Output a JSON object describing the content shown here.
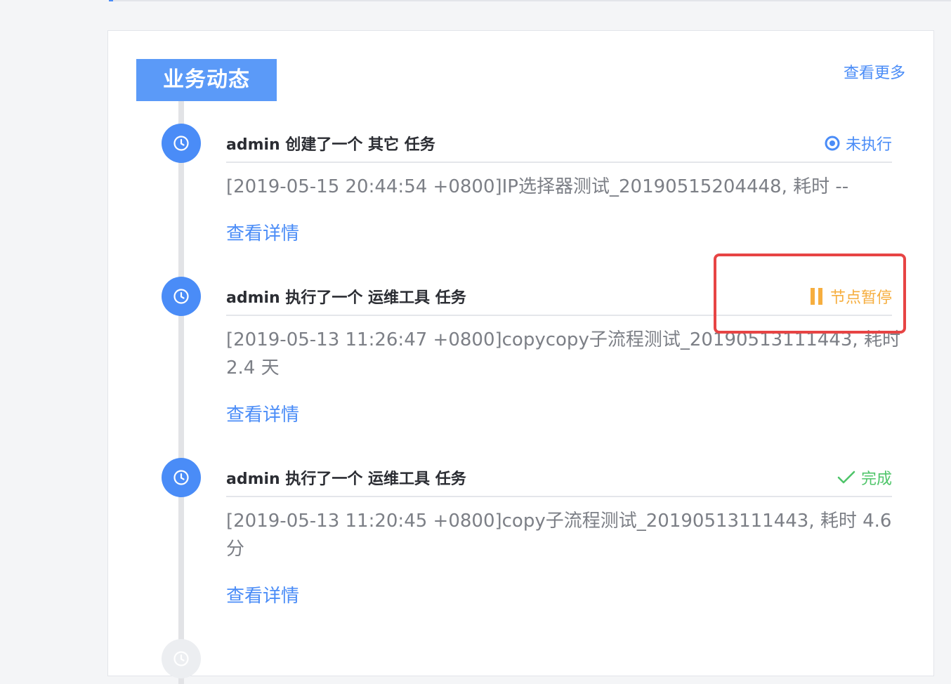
{
  "card": {
    "title": "业务动态",
    "view_more": "查看更多"
  },
  "entries": [
    {
      "header": "admin 创建了一个 其它 任务",
      "status": "未执行",
      "status_icon": "radio-dot-icon",
      "status_color": "#4a8cf7",
      "description": "[2019-05-15 20:44:54 +0800]IP选择器测试_20190515204448, 耗时 --",
      "detail_link": "查看详情"
    },
    {
      "header": "admin 执行了一个 运维工具 任务",
      "status": "节点暂停",
      "status_icon": "pause-icon",
      "status_color": "#f6ae3f",
      "description": "[2019-05-13 11:26:47 +0800]copycopy子流程测试_20190513111443, 耗时 2.4 天",
      "detail_link": "查看详情"
    },
    {
      "header": "admin 执行了一个 运维工具 任务",
      "status": "完成",
      "status_icon": "check-icon",
      "status_color": "#4fc56a",
      "description": "[2019-05-13 11:20:45 +0800]copy子流程测试_20190513111443, 耗时 4.6 分",
      "detail_link": "查看详情"
    }
  ],
  "colors": {
    "accent": "#4a8cf7",
    "title_bg": "#5b9af8",
    "highlight": "#e74444"
  }
}
